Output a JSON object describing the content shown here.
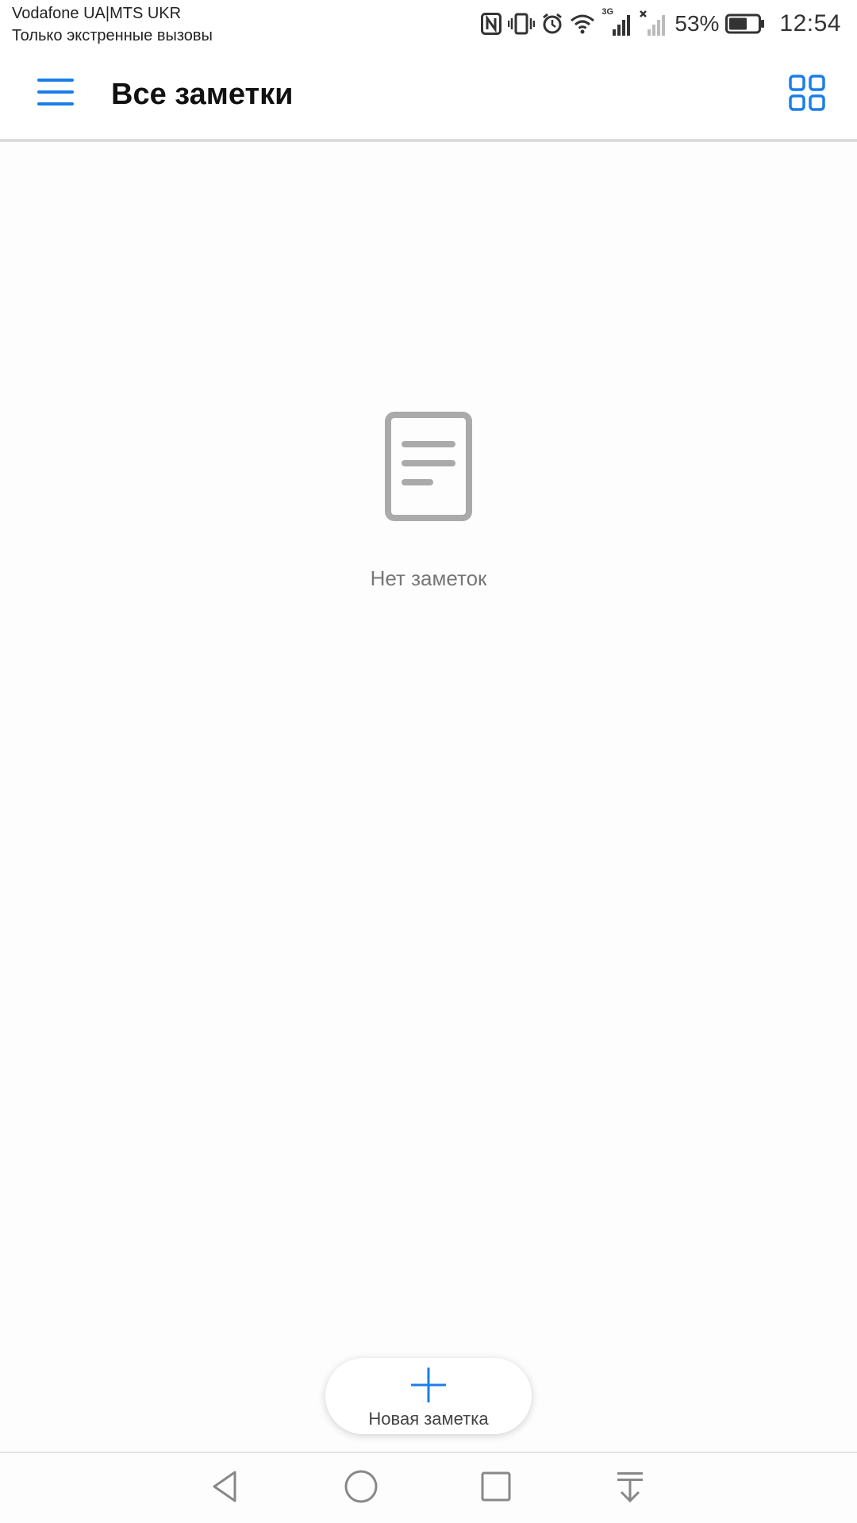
{
  "status_bar": {
    "carrier_line_1": "Vodafone UA|MTS UKR",
    "carrier_line_2": "Только экстренные вызовы",
    "network_type": "3G",
    "battery_percent": "53%",
    "time": "12:54",
    "icons": [
      "nfc-icon",
      "vibrate-icon",
      "alarm-icon",
      "wifi-icon",
      "signal-icon",
      "no-signal-icon",
      "battery-icon"
    ]
  },
  "app_bar": {
    "title": "Все заметки",
    "menu_icon": "hamburger-menu-icon",
    "view_toggle_icon": "grid-view-icon"
  },
  "empty_state": {
    "icon": "note-document-icon",
    "message": "Нет заметок"
  },
  "new_note": {
    "icon": "plus-icon",
    "label": "Новая заметка"
  },
  "nav_bar": {
    "buttons": [
      "back-icon",
      "home-icon",
      "recents-icon",
      "notifications-pull-icon"
    ]
  },
  "colors": {
    "accent": "#1a7ee8",
    "background": "#fdfdfd",
    "title_text": "#111111",
    "secondary_text": "#777777",
    "empty_icon": "#aaaaaa"
  }
}
